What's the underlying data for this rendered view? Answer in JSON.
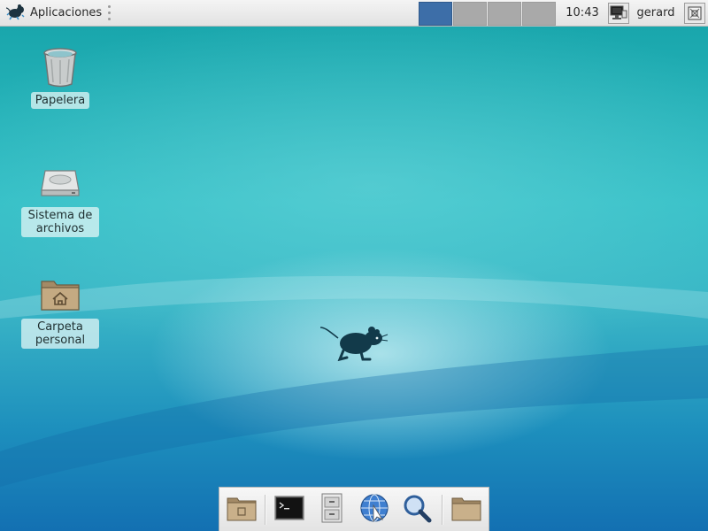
{
  "panel": {
    "app_menu_label": "Aplicaciones",
    "workspaces": [
      {
        "index": 1,
        "active": true
      },
      {
        "index": 2,
        "active": false
      },
      {
        "index": 3,
        "active": false
      },
      {
        "index": 4,
        "active": false
      }
    ],
    "clock": "10:43",
    "user": "gerard",
    "icons": {
      "app_menu": "xfce-mouse-icon",
      "network": "network-icon",
      "action": "action-buttons-icon"
    }
  },
  "desktop": {
    "icons": [
      {
        "label": "Papelera",
        "icon": "trash-icon"
      },
      {
        "label": "Sistema de archivos",
        "icon": "drive-icon"
      },
      {
        "label": "Carpeta personal",
        "icon": "home-folder-icon"
      }
    ],
    "logo": "xfce-mouse-logo"
  },
  "dock": {
    "items": [
      {
        "icon": "show-desktop-icon"
      },
      {
        "icon": "terminal-icon"
      },
      {
        "icon": "file-manager-icon"
      },
      {
        "icon": "web-browser-icon"
      },
      {
        "icon": "search-icon"
      },
      {
        "icon": "folder-icon"
      }
    ]
  },
  "colors": {
    "active_workspace": "#3d6ea8",
    "inactive_workspace": "#a9a9a9",
    "desktop_top": "#19a6ac",
    "desktop_bottom": "#1370b2"
  }
}
